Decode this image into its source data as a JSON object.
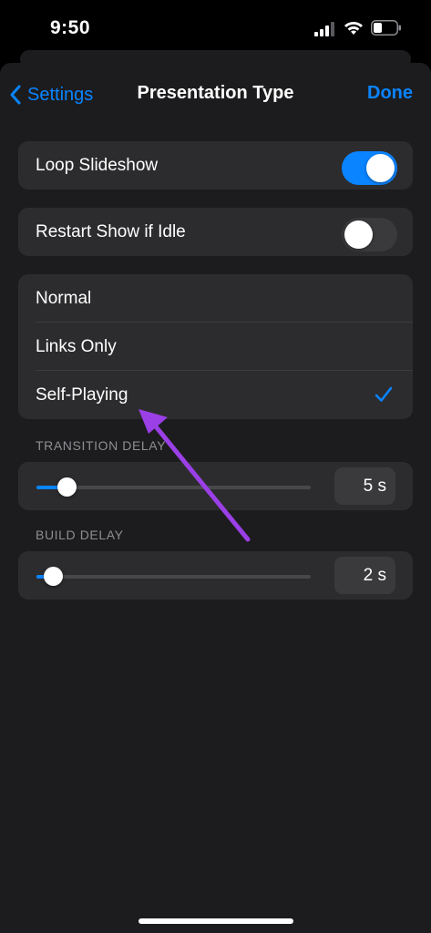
{
  "status": {
    "time": "9:50"
  },
  "nav": {
    "back_label": "Settings",
    "title": "Presentation Type",
    "done_label": "Done"
  },
  "toggles": [
    {
      "label": "Loop Slideshow",
      "on": true
    },
    {
      "label": "Restart Show if Idle",
      "on": false
    }
  ],
  "presentation_types": [
    {
      "label": "Normal",
      "selected": false
    },
    {
      "label": "Links Only",
      "selected": false
    },
    {
      "label": "Self-Playing",
      "selected": true
    }
  ],
  "transition_delay": {
    "header": "TRANSITION DELAY",
    "value_label": "5 s",
    "level": 0.11
  },
  "build_delay": {
    "header": "BUILD DELAY",
    "value_label": "2 s",
    "level": 0.06
  },
  "colors": {
    "accent": "#0a84ff",
    "annotation_arrow": "#9b3fe6",
    "background": "#1c1c1e",
    "cell": "#2c2c2e"
  }
}
